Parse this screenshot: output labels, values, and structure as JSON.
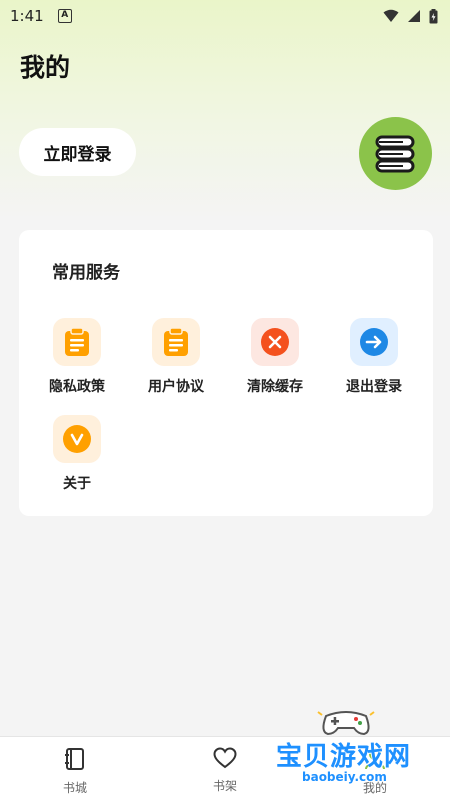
{
  "status_bar": {
    "time": "1:41",
    "notification_glyph": "A"
  },
  "header": {
    "title": "我的"
  },
  "login": {
    "label": "立即登录"
  },
  "services": {
    "title": "常用服务",
    "items": [
      {
        "label": "隐私政策",
        "icon": "clipboard-icon",
        "color": "#ffa000"
      },
      {
        "label": "用户协议",
        "icon": "clipboard-icon",
        "color": "#ffa000"
      },
      {
        "label": "清除缓存",
        "icon": "close-circle-icon",
        "color": "#f4511e"
      },
      {
        "label": "退出登录",
        "icon": "arrow-right-circle-icon",
        "color": "#1e88e5"
      },
      {
        "label": "关于",
        "icon": "chevron-down-circle-icon",
        "color": "#ffa000"
      }
    ]
  },
  "tabbar": {
    "items": [
      {
        "label": "书城",
        "icon": "book-icon"
      },
      {
        "label": "书架",
        "icon": "heart-icon"
      },
      {
        "label": "我的",
        "icon": "user-icon"
      }
    ]
  },
  "watermark": {
    "text": "宝贝游戏网",
    "url": "baobeiy.com"
  },
  "colors": {
    "accent_green": "#8bc34a",
    "orange": "#ffa000",
    "red": "#f4511e",
    "blue": "#1e88e5"
  }
}
